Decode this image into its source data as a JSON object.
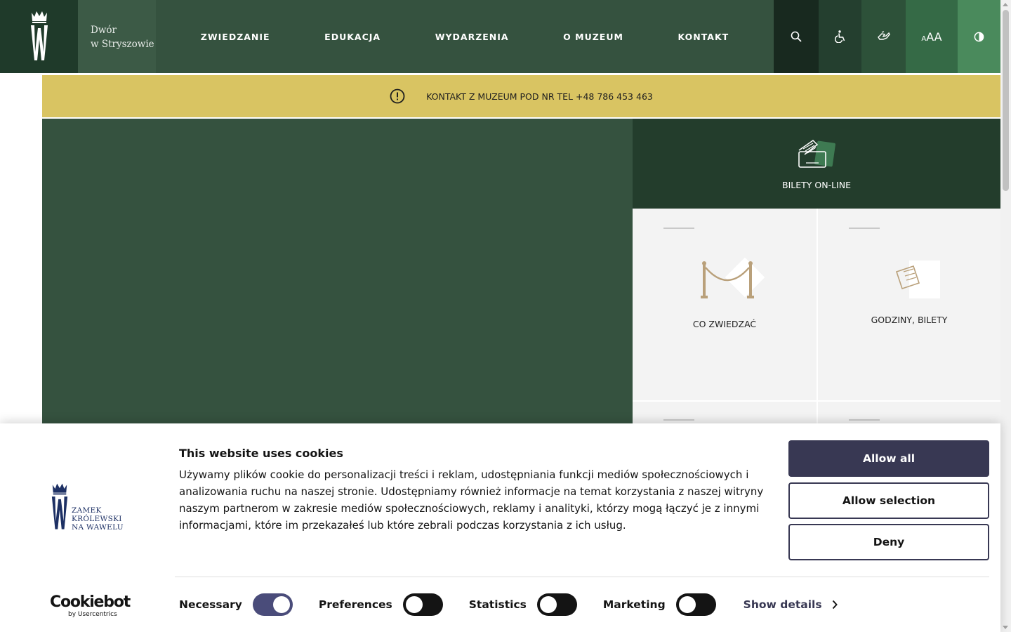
{
  "header": {
    "site_name_line1": "Dwór",
    "site_name_line2": "w Stryszowie",
    "nav": [
      "ZWIEDZANIE",
      "EDUKACJA",
      "WYDARZENIA",
      "O MUZEUM",
      "KONTAKT"
    ],
    "tools": {
      "search_icon": "search-icon",
      "accessibility_icon": "wheelchair-icon",
      "sign_language_icon": "sign-language-icon",
      "font_size_label": "AA",
      "font_size_small_label": "A",
      "contrast_icon": "contrast-icon"
    }
  },
  "notice": {
    "text": "KONTAKT Z MUZEUM POD NR TEL +48 786 453 463",
    "icon": "exclamation-icon",
    "color": "#d9c462"
  },
  "tiles": {
    "tickets_online": "BILETY ON-LINE",
    "what_to_visit": "CO ZWIEDZAĆ",
    "hours_tickets": "GODZINY, BILETY"
  },
  "cookie_banner": {
    "logo_text": [
      "ZAMEK",
      "KRÓLEWSKI",
      "NA WAWELU"
    ],
    "title": "This website uses cookies",
    "body": "Używamy plików cookie do personalizacji treści i reklam, udostępniania funkcji mediów społecznościowych i analizowania ruchu na naszej stronie. Udostępniamy również informacje na temat korzystania z naszej witryny naszym partnerom w zakresie mediów społecznościowych, reklamy i analityki, którzy mogą łączyć je z innymi informacjami, które im przekazałeś lub które zebrali podczas korzystania z ich usług.",
    "buttons": {
      "allow_all": "Allow all",
      "allow_selection": "Allow selection",
      "deny": "Deny"
    },
    "toggles": {
      "necessary": "Necessary",
      "preferences": "Preferences",
      "statistics": "Statistics",
      "marketing": "Marketing"
    },
    "toggle_states": {
      "necessary": true,
      "preferences": false,
      "statistics": false,
      "marketing": false
    },
    "show_details": "Show details",
    "provider": "Cookiebot",
    "provider_sub": "by Usercentrics",
    "accent_color": "#383853"
  }
}
